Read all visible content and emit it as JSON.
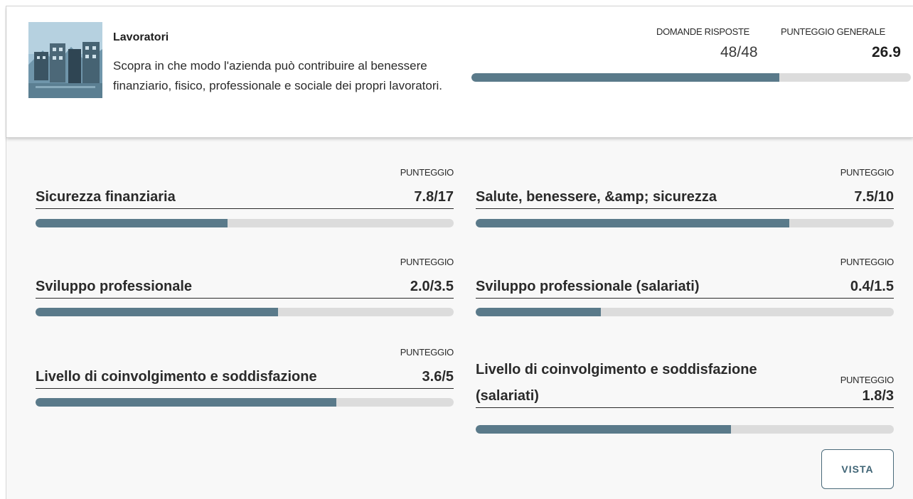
{
  "header": {
    "title": "Lavoratori",
    "description": "Scopra in che modo l'azienda può contribuire al benessere finanziario, fisico, professionale e sociale dei propri lavoratori.",
    "questions_label": "DOMANDE RISPOSTE",
    "questions_value": "48/48",
    "score_label": "PUNTEGGIO GENERALE",
    "score_value": "26.9",
    "progress": 0.7
  },
  "categories": [
    {
      "title": "Sicurezza finanziaria",
      "score_label": "PUNTEGGIO",
      "score": "7.8/17",
      "progress": 0.46
    },
    {
      "title": "Salute, benessere, &amp; sicurezza",
      "score_label": "PUNTEGGIO",
      "score": "7.5/10",
      "progress": 0.75
    },
    {
      "title": "Sviluppo professionale",
      "score_label": "PUNTEGGIO",
      "score": "2.0/3.5",
      "progress": 0.58
    },
    {
      "title": "Sviluppo professionale (salariati)",
      "score_label": "PUNTEGGIO",
      "score": "0.4/1.5",
      "progress": 0.3
    },
    {
      "title": "Livello di coinvolgimento e soddisfazione",
      "score_label": "PUNTEGGIO",
      "score": "3.6/5",
      "progress": 0.72
    },
    {
      "title_line1": "Livello di coinvolgimento e soddisfazione",
      "title_line2": "(salariati)",
      "score_label": "PUNTEGGIO",
      "score": "1.8/3",
      "progress": 0.61
    }
  ],
  "actions": {
    "view_label": "VISTA"
  },
  "colors": {
    "bar_fill": "#5a7a8a",
    "bar_track": "#dcdcdc",
    "button_text": "#3f6475"
  }
}
